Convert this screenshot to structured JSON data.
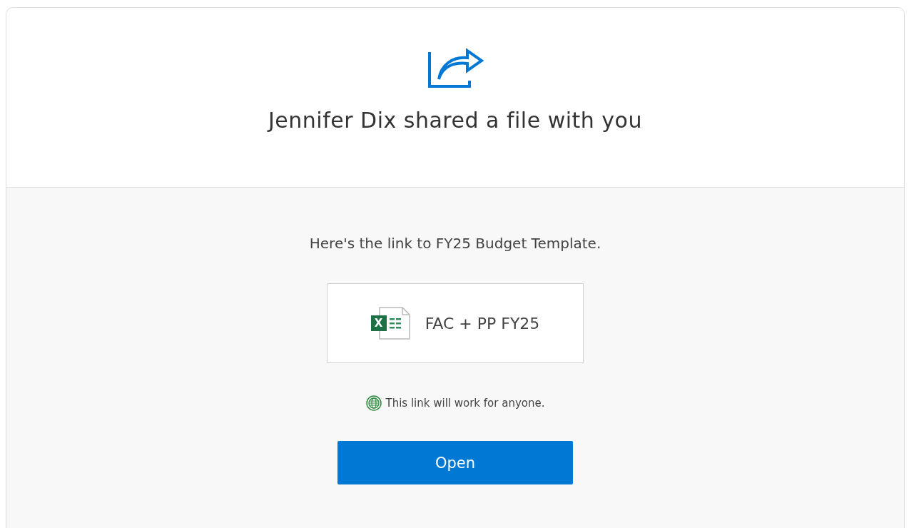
{
  "header": {
    "title": "Jennifer Dix shared a file with you"
  },
  "message": "Here's the link to FY25 Budget Template.",
  "file": {
    "name": "FAC + PP FY25",
    "icon_text": "X"
  },
  "access_note": "This link will work for anyone.",
  "button": {
    "label": "Open"
  }
}
